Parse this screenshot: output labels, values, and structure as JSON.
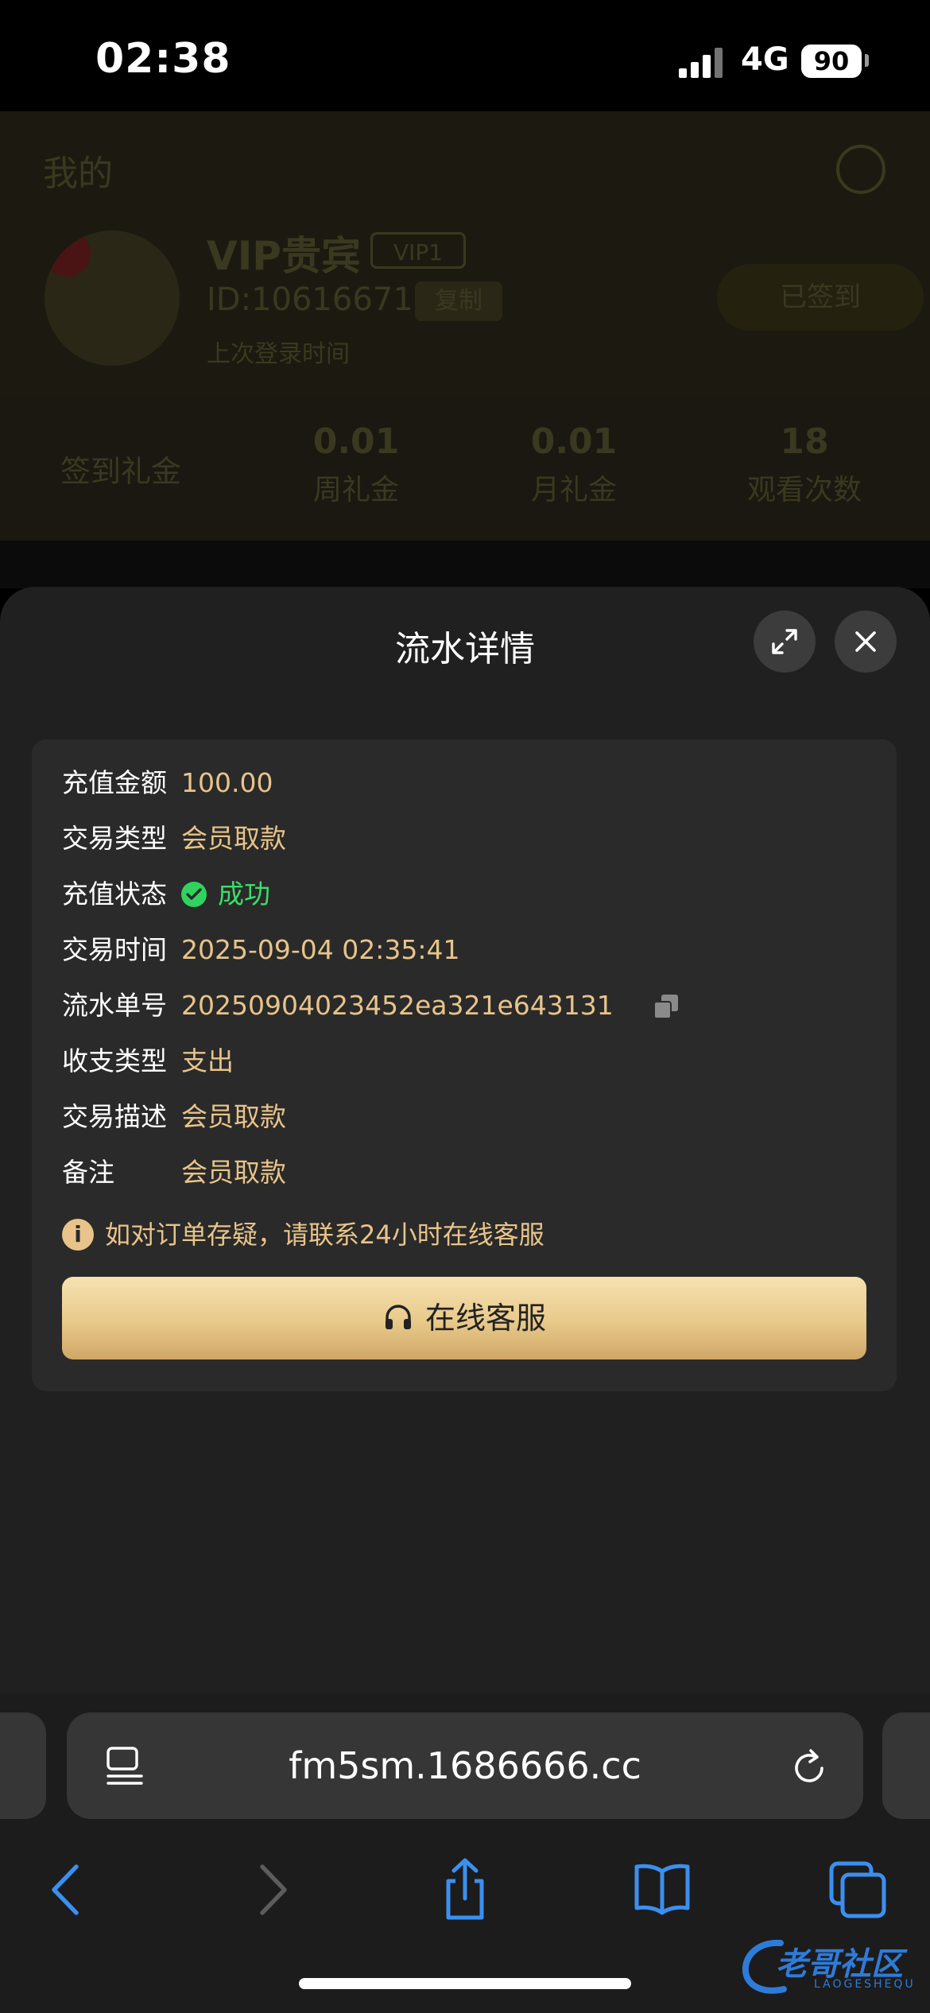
{
  "status_bar": {
    "time": "02:38",
    "network": "4G",
    "battery": "90"
  },
  "background_page": {
    "title": "我的",
    "user_name": "VIP贵宾",
    "vip_badge": "VIP1",
    "user_id": "ID:10616671",
    "copy_label": "复制",
    "last_login": "上次登录时间",
    "signed_label": "已签到",
    "signin_bonus_label": "签到礼金",
    "stats": [
      {
        "value": "0.01",
        "label": "周礼金"
      },
      {
        "value": "0.01",
        "label": "月礼金"
      },
      {
        "value": "18",
        "label": "观看次数"
      }
    ]
  },
  "modal": {
    "title": "流水详情",
    "details": [
      {
        "label": "充值金额",
        "value": "100.00"
      },
      {
        "label": "交易类型",
        "value": "会员取款"
      },
      {
        "label": "充值状态",
        "value": "成功"
      },
      {
        "label": "交易时间",
        "value": "2025-09-04 02:35:41"
      },
      {
        "label": "流水单号",
        "value": "20250904023452ea321e643131"
      },
      {
        "label": "收支类型",
        "value": "支出"
      },
      {
        "label": "交易描述",
        "value": "会员取款"
      },
      {
        "label": "备注",
        "value": "会员取款"
      }
    ],
    "notice": "如对订单存疑，请联系24小时在线客服",
    "support_button": "在线客服"
  },
  "browser": {
    "url": "fm5sm.1686666.cc"
  },
  "watermark": {
    "text": "老哥社区",
    "sub": "LAOGESHEQU"
  },
  "colors": {
    "accent_gold": "#e8c48a",
    "success": "#2fd35e",
    "link_blue": "#3b8ff0"
  }
}
